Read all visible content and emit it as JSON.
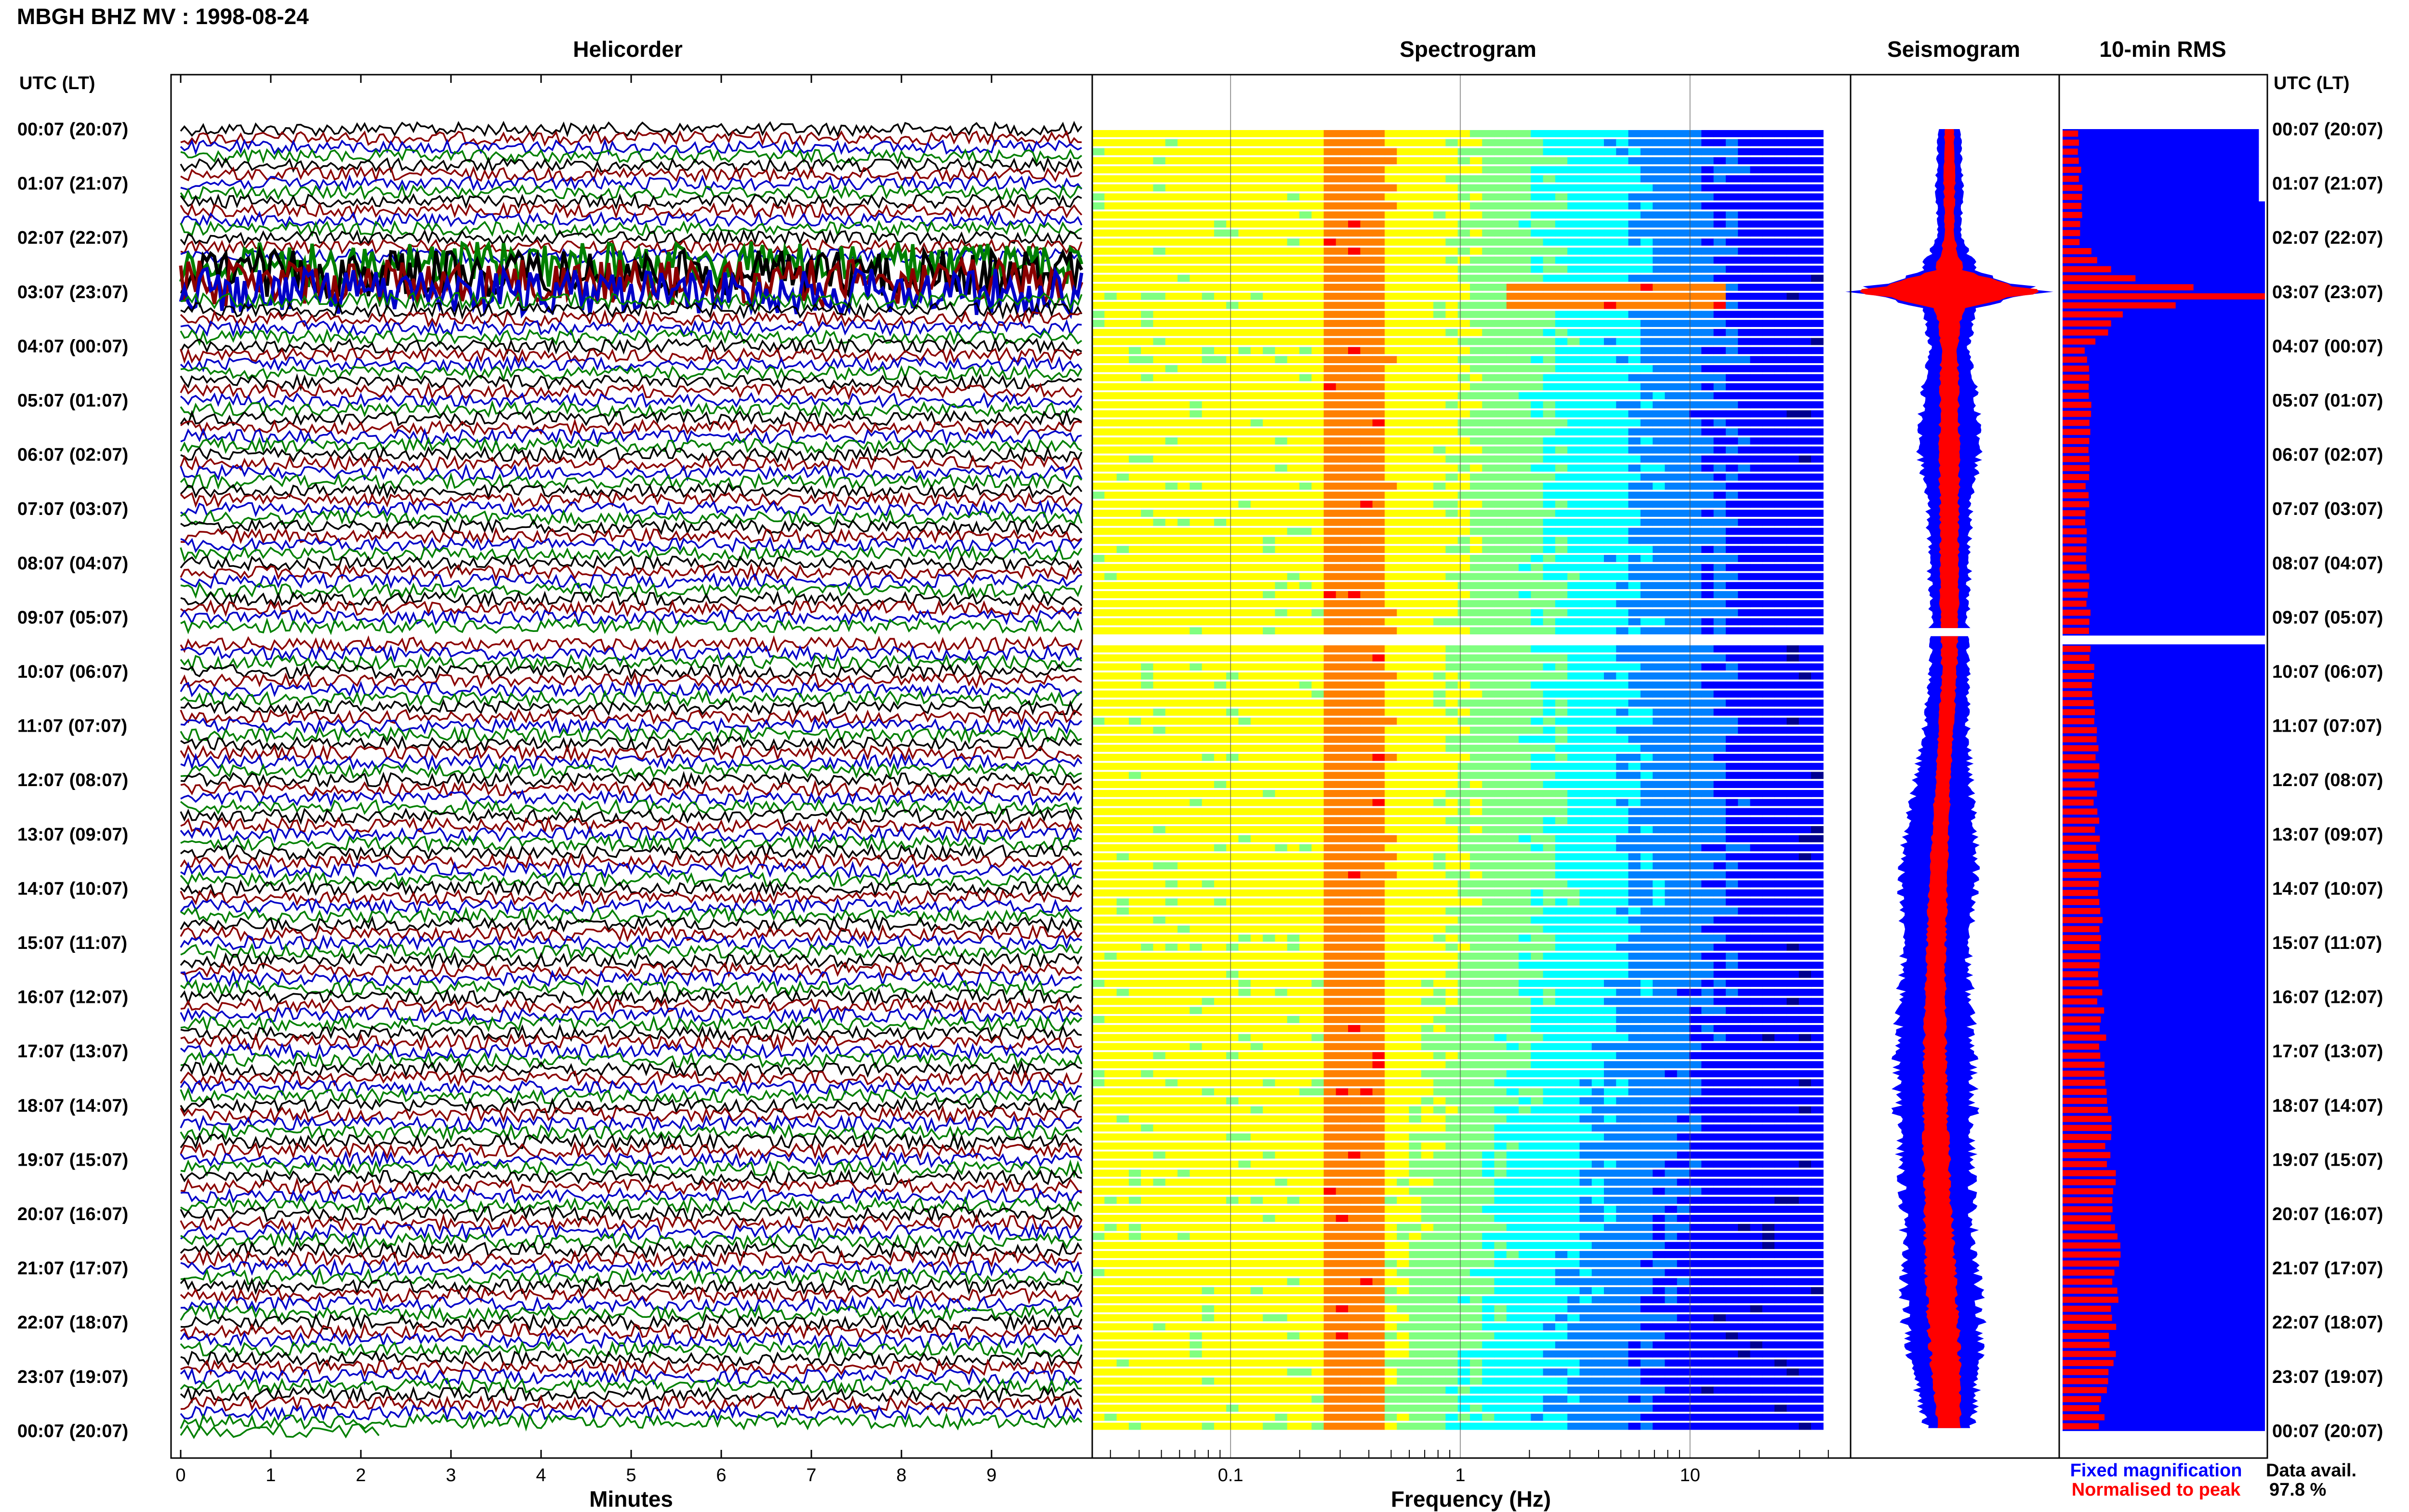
{
  "header": {
    "title": "MBGH BHZ MV : 1998-08-24",
    "time_axis_label": "UTC (LT)"
  },
  "panels": {
    "helicorder": "Helicorder",
    "spectrogram": "Spectrogram",
    "seismogram": "Seismogram",
    "rms": "10-min RMS"
  },
  "axes": {
    "minutes_label": "Minutes",
    "minutes_ticks": [
      "0",
      "1",
      "2",
      "3",
      "4",
      "5",
      "6",
      "7",
      "8",
      "9"
    ],
    "frequency_label": "Frequency (Hz)",
    "frequency_ticks": [
      "0.1",
      "1",
      "10"
    ]
  },
  "time_labels": [
    "00:07 (20:07)",
    "01:07 (21:07)",
    "02:07 (22:07)",
    "03:07 (23:07)",
    "04:07 (00:07)",
    "05:07 (01:07)",
    "06:07 (02:07)",
    "07:07 (03:07)",
    "08:07 (04:07)",
    "09:07 (05:07)",
    "10:07 (06:07)",
    "11:07 (07:07)",
    "12:07 (08:07)",
    "13:07 (09:07)",
    "14:07 (10:07)",
    "15:07 (11:07)",
    "16:07 (12:07)",
    "17:07 (13:07)",
    "18:07 (14:07)",
    "19:07 (15:07)",
    "20:07 (16:07)",
    "21:07 (17:07)",
    "22:07 (18:07)",
    "23:07 (19:07)",
    "00:07 (20:07)"
  ],
  "legend": {
    "fixed": "Fixed magnification",
    "fixed_color": "#0000ff",
    "normalised": "Normalised to peak",
    "normalised_color": "#ff0000"
  },
  "availability": {
    "label": "Data avail.",
    "value": "97.8 %"
  },
  "colors": {
    "trace_cycle": [
      "#000000",
      "#8b0000",
      "#0000c8",
      "#008000"
    ],
    "spectrogram_colormap": [
      "#00008f",
      "#0000ff",
      "#0080ff",
      "#00ffff",
      "#80ff80",
      "#ffff00",
      "#ff8000",
      "#ff0000",
      "#800000"
    ]
  },
  "chart_data": {
    "type": "heatmap",
    "title": "MBGH BHZ MV : 1998-08-24",
    "rows_per_hour": 6,
    "row_count": 144,
    "data_gap_hours": [
      9.2,
      9.35
    ],
    "helicorder": {
      "xlabel": "Minutes",
      "xlim": [
        0,
        10
      ],
      "ylabel": "UTC (LT)",
      "event_hours": [
        2.4,
        3.0
      ]
    },
    "spectrogram": {
      "xlabel": "Frequency (Hz)",
      "xlim": [
        0.025,
        50
      ],
      "x_scale": "log",
      "peak_band_hz": [
        0.25,
        0.45
      ],
      "event_peak_hz": 5,
      "event_hour": 3.0
    },
    "seismogram_envelope": {
      "hours": [
        0,
        1,
        2,
        2.6,
        3,
        3.3,
        4,
        5,
        6,
        7,
        8,
        9,
        10,
        11,
        12,
        13,
        14,
        15,
        16,
        17,
        18,
        19,
        20,
        21,
        22,
        23,
        24
      ],
      "fixed": [
        0.12,
        0.14,
        0.13,
        0.3,
        1.0,
        0.3,
        0.2,
        0.3,
        0.33,
        0.23,
        0.22,
        0.2,
        0.21,
        0.24,
        0.3,
        0.38,
        0.4,
        0.35,
        0.38,
        0.42,
        0.42,
        0.4,
        0.38,
        0.4,
        0.42,
        0.35,
        0.25
      ],
      "normalised": [
        0.05,
        0.06,
        0.05,
        0.15,
        1.0,
        0.15,
        0.09,
        0.1,
        0.11,
        0.1,
        0.1,
        0.1,
        0.08,
        0.08,
        0.08,
        0.09,
        0.1,
        0.1,
        0.11,
        0.12,
        0.13,
        0.14,
        0.15,
        0.16,
        0.17,
        0.15,
        0.12
      ]
    },
    "rms": {
      "hours": [
        0,
        1,
        2,
        2.6,
        3,
        3.3,
        4,
        5,
        6,
        7,
        8,
        9,
        10,
        11,
        12,
        13,
        14,
        15,
        16,
        17,
        18,
        19,
        20,
        21,
        22,
        23,
        24
      ],
      "values": [
        0.08,
        0.09,
        0.09,
        0.25,
        1.0,
        0.3,
        0.12,
        0.13,
        0.13,
        0.12,
        0.12,
        0.13,
        0.15,
        0.16,
        0.17,
        0.17,
        0.18,
        0.18,
        0.19,
        0.2,
        0.22,
        0.24,
        0.26,
        0.27,
        0.26,
        0.22,
        0.18
      ]
    }
  }
}
